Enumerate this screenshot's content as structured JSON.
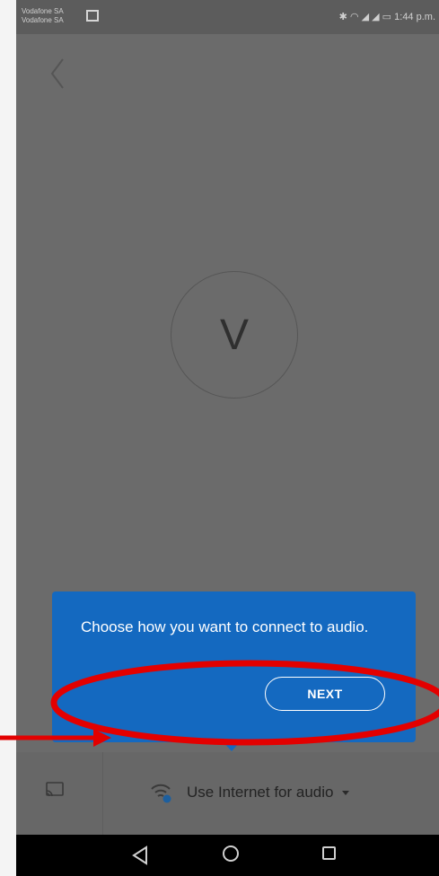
{
  "status_bar": {
    "carrier_line1": "Vodafone SA",
    "carrier_line2": "Vodafone SA",
    "right_text": "1:44 p.m."
  },
  "participant": {
    "initial": "V"
  },
  "tooltip": {
    "message": "Choose how you want to connect to audio.",
    "next_label": "NEXT"
  },
  "bottom_bar": {
    "audio_label": "Use Internet for audio"
  },
  "colors": {
    "tooltip_blue": "#1469c0",
    "annotation_red": "#e30000",
    "overlay_gray": "#6b6b6b"
  }
}
